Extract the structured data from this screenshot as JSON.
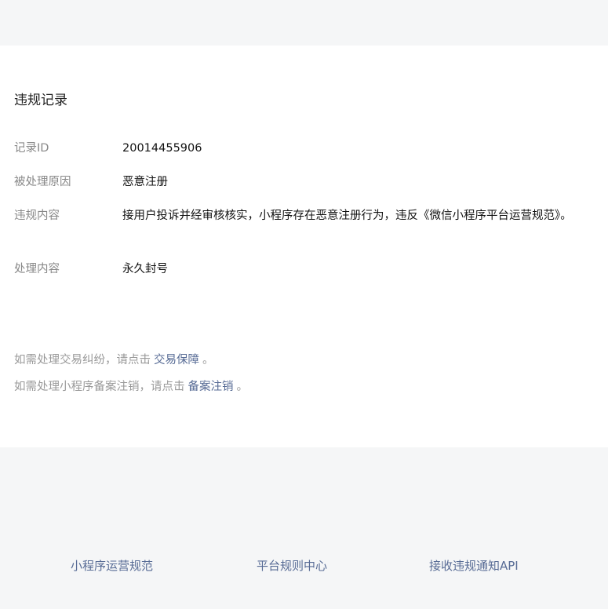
{
  "record": {
    "title": "违规记录",
    "fields": [
      {
        "label": "记录ID",
        "value": "20014455906"
      },
      {
        "label": "被处理原因",
        "value": "恶意注册"
      },
      {
        "label": "违规内容",
        "value": "接用户投诉并经审核核实，小程序存在恶意注册行为，违反《微信小程序平台运营规范》。"
      },
      {
        "label": "处理内容",
        "value": "永久封号"
      }
    ]
  },
  "notes": {
    "trade": {
      "prefix": "如需处理交易纠纷，请点击",
      "link": "交易保障",
      "suffix": "。"
    },
    "filing": {
      "prefix": "如需处理小程序备案注销，请点击",
      "link": "备案注销",
      "suffix": "。"
    }
  },
  "footer": {
    "links": [
      "小程序运营规范",
      "平台规则中心",
      "接收违规通知API"
    ]
  },
  "colors": {
    "background": "#f5f6f7",
    "card": "#ffffff",
    "label": "#888888",
    "link": "#576b95",
    "note": "#999999"
  }
}
